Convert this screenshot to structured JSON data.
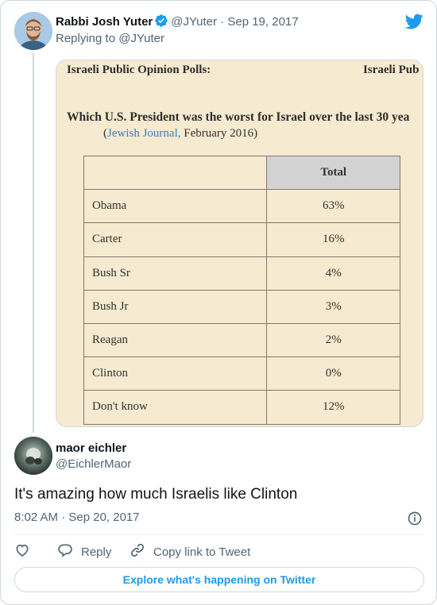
{
  "parent": {
    "name": "Rabbi Josh Yuter",
    "meta": "@JYuter · Sep 19, 2017",
    "replying": "Replying to @JYuter",
    "media": {
      "heading_left": "Israeli Public Opinion Polls:",
      "heading_right": "Israeli Pub",
      "question": "Which U.S. President was the worst for Israel over the last 30 yea",
      "source_open": "(",
      "source_link": "Jewish Journal,",
      "source_rest": " February 2016)",
      "table": {
        "header": "Total",
        "rows": [
          {
            "name": "Obama",
            "value": "63%"
          },
          {
            "name": "Carter",
            "value": "16%"
          },
          {
            "name": "Bush Sr",
            "value": "4%"
          },
          {
            "name": "Bush Jr",
            "value": "3%"
          },
          {
            "name": "Reagan",
            "value": "2%"
          },
          {
            "name": "Clinton",
            "value": "0%"
          },
          {
            "name": "Don't know",
            "value": "12%"
          }
        ]
      }
    }
  },
  "reply": {
    "name": "maor eichler",
    "handle": "@EichlerMaor",
    "text": "It's amazing how much Israelis like Clinton",
    "time": "8:02 AM · Sep 20, 2017"
  },
  "actions": {
    "reply": "Reply",
    "copy_link": "Copy link to Tweet"
  },
  "explore": "Explore what's happening on Twitter",
  "colors": {
    "accent": "#1d9bf0",
    "muted": "#536471",
    "media_bg": "#f6ead0",
    "table_header_bg": "#d3d3d3"
  },
  "icons": [
    "verified-badge-icon",
    "twitter-bird-icon",
    "info-icon",
    "heart-icon",
    "reply-icon",
    "link-icon"
  ]
}
